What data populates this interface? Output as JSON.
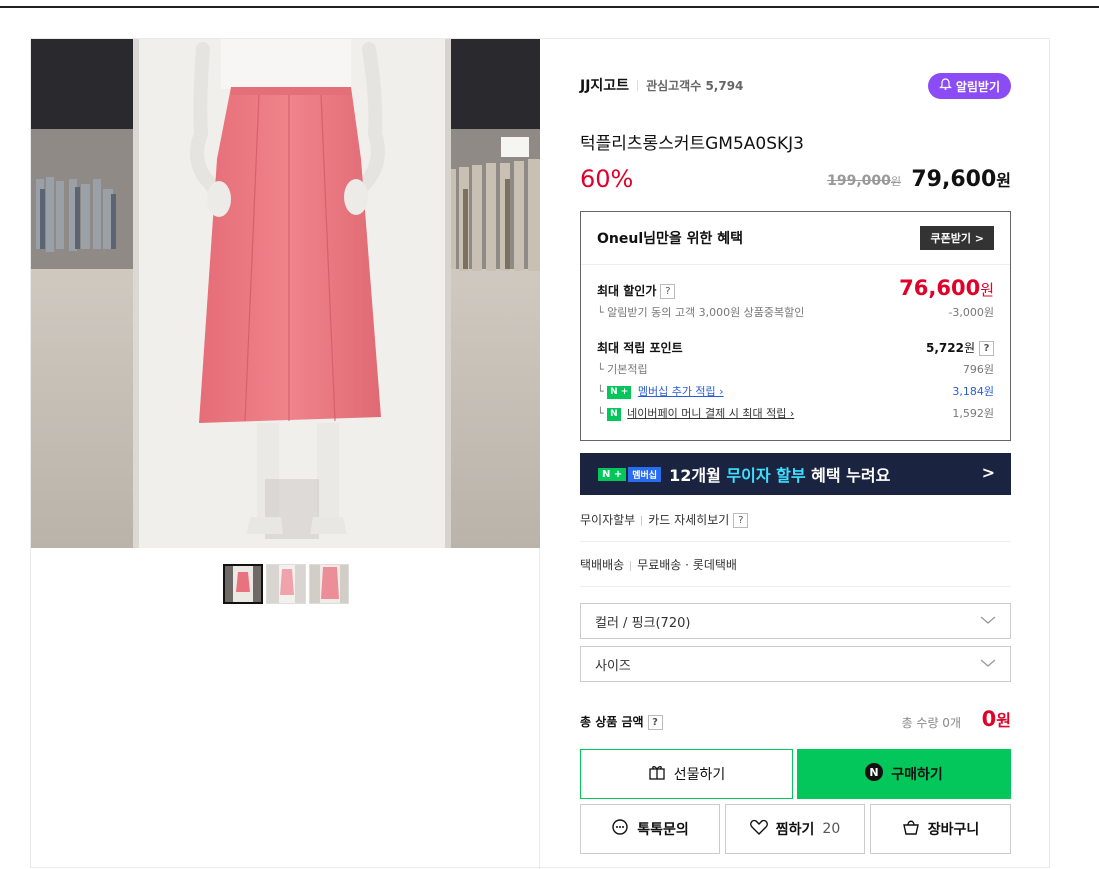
{
  "brand": {
    "name": "JJ지고트",
    "fav_label": "관심고객수",
    "fav_count": "5,794",
    "alarm_label": "알림받기"
  },
  "product": {
    "title": "턱플리츠롱스커트GM5A0SKJ3",
    "discount_rate": "60%",
    "original_price": "199,000",
    "original_won": "원",
    "sale_price": "79,600",
    "sale_won": "원"
  },
  "benefit": {
    "title": "Oneul님만을 위한 혜택",
    "coupon_label": "쿠폰받기 >",
    "max_discount_label": "최대 할인가",
    "max_discount_price": "76,600",
    "max_discount_won": "원",
    "alarm_sub": "알림받기 동의 고객 3,000원 상품중복할인",
    "alarm_sub_amount": "-3,000원",
    "max_point_label": "최대 적립 포인트",
    "max_point_value": "5,722",
    "max_point_won": "원",
    "basic_label": "기본적립",
    "basic_value": "796원",
    "member_label": "멤버십 추가 적립",
    "member_value": "3,184원",
    "npay_label": "네이버페이 머니 결제 시 최대 적립",
    "npay_value": "1,592원"
  },
  "banner": {
    "pill_n": "N +",
    "pill_mem": "멤버십",
    "text_a": "12개월",
    "text_hl": "무이자 할부",
    "text_b": "혜택 누려요",
    "arrow": ">"
  },
  "card_row": {
    "a": "무이자할부",
    "b": "카드 자세히보기"
  },
  "delivery_row": {
    "a": "택배배송",
    "b": "무료배송 · 롯데택배"
  },
  "options": {
    "color": "컬러 / 핑크(720)",
    "size": "사이즈"
  },
  "total": {
    "label": "총 상품 금액",
    "qty_label": "총 수량 0개",
    "sum": "0",
    "sum_won": "원"
  },
  "buttons": {
    "gift": "선물하기",
    "buy": "구매하기",
    "chat": "톡톡문의",
    "wish": "찜하기",
    "wish_count": "20",
    "cart": "장바구니"
  },
  "qmark": "?",
  "colors": {
    "accent_red": "#e0002a",
    "naver_green": "#03c75a",
    "alarm_purple": "#8b4cf6",
    "banner_navy": "#1a2340"
  }
}
